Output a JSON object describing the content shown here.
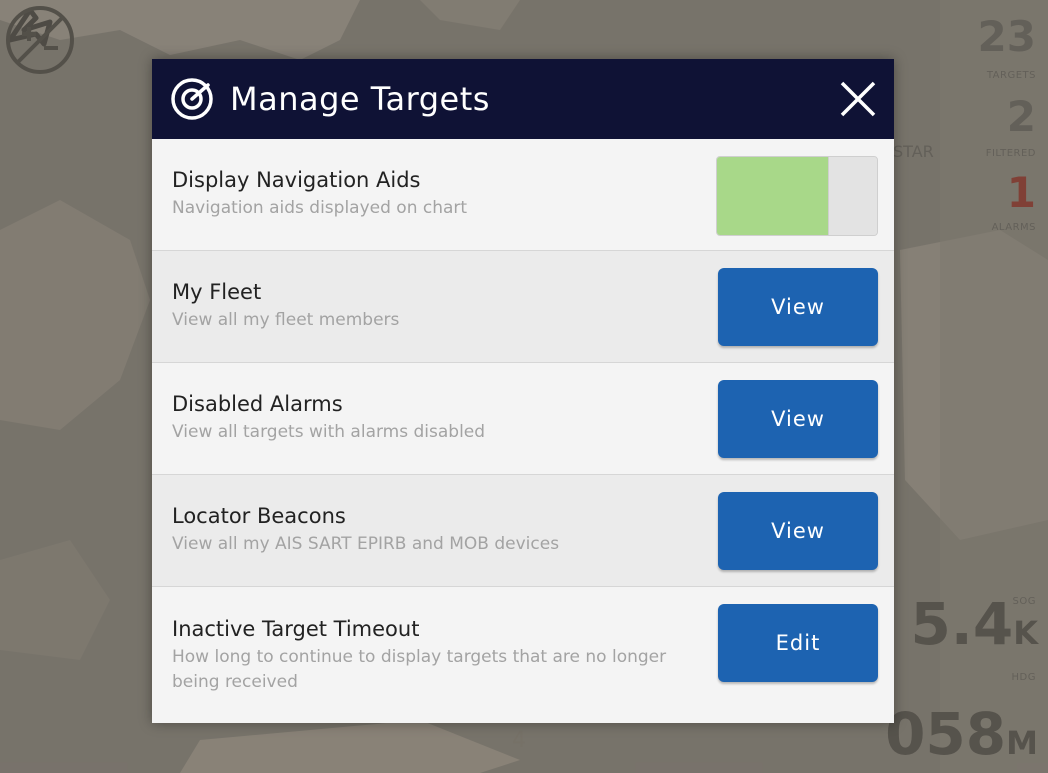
{
  "dialog": {
    "title": "Manage Targets",
    "header_icon": "target-icon",
    "close_icon": "close-icon",
    "rows": [
      {
        "title": "Display Navigation Aids",
        "subtitle": "Navigation aids displayed on chart",
        "control": "toggle",
        "toggle_on": true,
        "toggle_fill": 0.7
      },
      {
        "title": "My Fleet",
        "subtitle": "View all my fleet members",
        "control": "button",
        "button_label": "View"
      },
      {
        "title": "Disabled Alarms",
        "subtitle": "View all targets with alarms disabled",
        "control": "button",
        "button_label": "View"
      },
      {
        "title": "Locator Beacons",
        "subtitle": "View all my AIS SART EPIRB and MOB devices",
        "control": "button",
        "button_label": "View"
      },
      {
        "title": "Inactive Target Timeout",
        "subtitle": "How long to continue to display targets that are no longer being received",
        "control": "button",
        "button_label": "Edit"
      }
    ]
  },
  "background": {
    "targets_count": "23",
    "targets_label": "TARGETS",
    "filtered_count": "2",
    "filtered_label": "FILTERED",
    "alarms_count": "1",
    "alarms_label": "ALARMS",
    "vessel_label": "STAR",
    "sog_label": "SOG",
    "sog_value": "5.4",
    "sog_unit": "K",
    "hdg_label": "HDG",
    "hdg_value": "058",
    "hdg_unit": "M",
    "scale_mark": "4",
    "compass_icon": "north-arrow-icon",
    "zoom_icon": "zoom-plus-minus-icon"
  },
  "colors": {
    "header_bg": "#0f1235",
    "button_bg": "#1d63b1",
    "toggle_on": "#a8d889",
    "alarm": "#9a3a2e"
  }
}
